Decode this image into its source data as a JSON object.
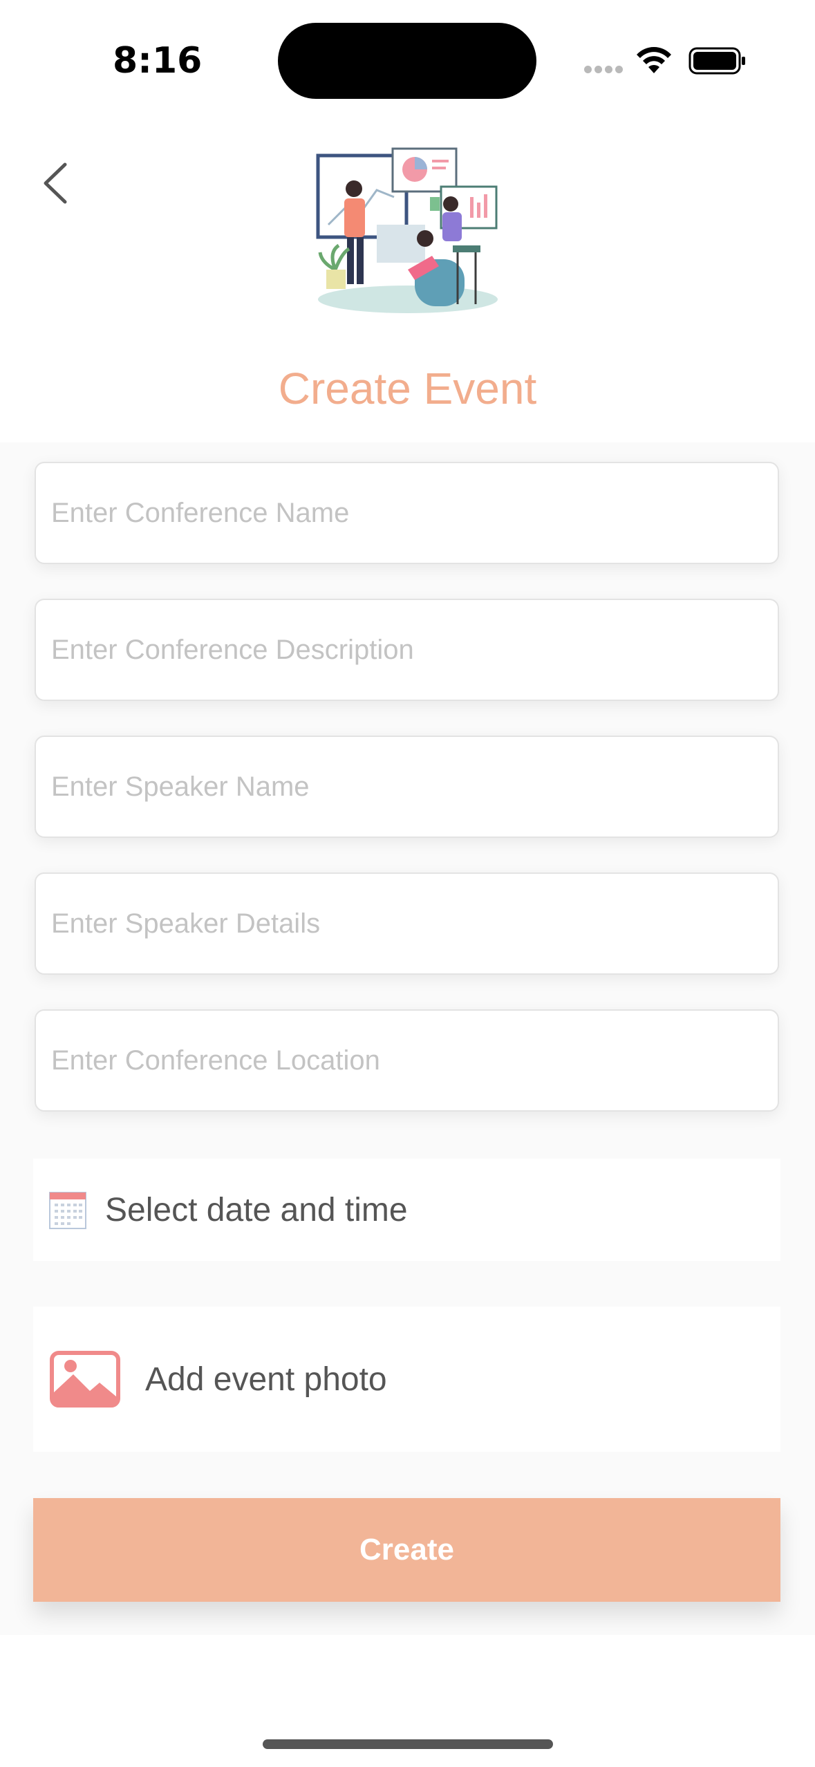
{
  "status_bar": {
    "time": "8:16"
  },
  "header": {
    "title": "Create Event"
  },
  "form": {
    "fields": [
      {
        "placeholder": "Enter Conference Name",
        "value": ""
      },
      {
        "placeholder": "Enter Conference Description",
        "value": ""
      },
      {
        "placeholder": "Enter Speaker Name",
        "value": ""
      },
      {
        "placeholder": "Enter Speaker Details",
        "value": ""
      },
      {
        "placeholder": "Enter Conference Location",
        "value": ""
      }
    ],
    "date_picker_label": "Select date and time",
    "photo_label": "Add event photo",
    "submit_label": "Create"
  },
  "colors": {
    "accent": "#f2ad8d",
    "button": "#f2b597",
    "photo_icon": "#f08a8a"
  }
}
